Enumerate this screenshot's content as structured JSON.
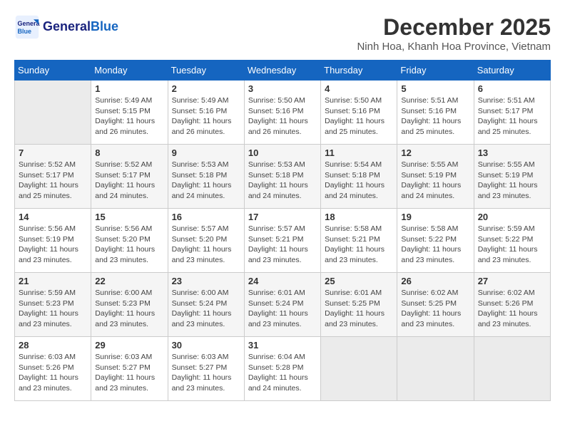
{
  "header": {
    "logo_line1": "General",
    "logo_line2": "Blue",
    "month": "December 2025",
    "location": "Ninh Hoa, Khanh Hoa Province, Vietnam"
  },
  "weekdays": [
    "Sunday",
    "Monday",
    "Tuesday",
    "Wednesday",
    "Thursday",
    "Friday",
    "Saturday"
  ],
  "weeks": [
    [
      {
        "day": "",
        "info": ""
      },
      {
        "day": "1",
        "info": "Sunrise: 5:49 AM\nSunset: 5:15 PM\nDaylight: 11 hours\nand 26 minutes."
      },
      {
        "day": "2",
        "info": "Sunrise: 5:49 AM\nSunset: 5:16 PM\nDaylight: 11 hours\nand 26 minutes."
      },
      {
        "day": "3",
        "info": "Sunrise: 5:50 AM\nSunset: 5:16 PM\nDaylight: 11 hours\nand 26 minutes."
      },
      {
        "day": "4",
        "info": "Sunrise: 5:50 AM\nSunset: 5:16 PM\nDaylight: 11 hours\nand 25 minutes."
      },
      {
        "day": "5",
        "info": "Sunrise: 5:51 AM\nSunset: 5:16 PM\nDaylight: 11 hours\nand 25 minutes."
      },
      {
        "day": "6",
        "info": "Sunrise: 5:51 AM\nSunset: 5:17 PM\nDaylight: 11 hours\nand 25 minutes."
      }
    ],
    [
      {
        "day": "7",
        "info": "Sunrise: 5:52 AM\nSunset: 5:17 PM\nDaylight: 11 hours\nand 25 minutes."
      },
      {
        "day": "8",
        "info": "Sunrise: 5:52 AM\nSunset: 5:17 PM\nDaylight: 11 hours\nand 24 minutes."
      },
      {
        "day": "9",
        "info": "Sunrise: 5:53 AM\nSunset: 5:18 PM\nDaylight: 11 hours\nand 24 minutes."
      },
      {
        "day": "10",
        "info": "Sunrise: 5:53 AM\nSunset: 5:18 PM\nDaylight: 11 hours\nand 24 minutes."
      },
      {
        "day": "11",
        "info": "Sunrise: 5:54 AM\nSunset: 5:18 PM\nDaylight: 11 hours\nand 24 minutes."
      },
      {
        "day": "12",
        "info": "Sunrise: 5:55 AM\nSunset: 5:19 PM\nDaylight: 11 hours\nand 24 minutes."
      },
      {
        "day": "13",
        "info": "Sunrise: 5:55 AM\nSunset: 5:19 PM\nDaylight: 11 hours\nand 23 minutes."
      }
    ],
    [
      {
        "day": "14",
        "info": "Sunrise: 5:56 AM\nSunset: 5:19 PM\nDaylight: 11 hours\nand 23 minutes."
      },
      {
        "day": "15",
        "info": "Sunrise: 5:56 AM\nSunset: 5:20 PM\nDaylight: 11 hours\nand 23 minutes."
      },
      {
        "day": "16",
        "info": "Sunrise: 5:57 AM\nSunset: 5:20 PM\nDaylight: 11 hours\nand 23 minutes."
      },
      {
        "day": "17",
        "info": "Sunrise: 5:57 AM\nSunset: 5:21 PM\nDaylight: 11 hours\nand 23 minutes."
      },
      {
        "day": "18",
        "info": "Sunrise: 5:58 AM\nSunset: 5:21 PM\nDaylight: 11 hours\nand 23 minutes."
      },
      {
        "day": "19",
        "info": "Sunrise: 5:58 AM\nSunset: 5:22 PM\nDaylight: 11 hours\nand 23 minutes."
      },
      {
        "day": "20",
        "info": "Sunrise: 5:59 AM\nSunset: 5:22 PM\nDaylight: 11 hours\nand 23 minutes."
      }
    ],
    [
      {
        "day": "21",
        "info": "Sunrise: 5:59 AM\nSunset: 5:23 PM\nDaylight: 11 hours\nand 23 minutes."
      },
      {
        "day": "22",
        "info": "Sunrise: 6:00 AM\nSunset: 5:23 PM\nDaylight: 11 hours\nand 23 minutes."
      },
      {
        "day": "23",
        "info": "Sunrise: 6:00 AM\nSunset: 5:24 PM\nDaylight: 11 hours\nand 23 minutes."
      },
      {
        "day": "24",
        "info": "Sunrise: 6:01 AM\nSunset: 5:24 PM\nDaylight: 11 hours\nand 23 minutes."
      },
      {
        "day": "25",
        "info": "Sunrise: 6:01 AM\nSunset: 5:25 PM\nDaylight: 11 hours\nand 23 minutes."
      },
      {
        "day": "26",
        "info": "Sunrise: 6:02 AM\nSunset: 5:25 PM\nDaylight: 11 hours\nand 23 minutes."
      },
      {
        "day": "27",
        "info": "Sunrise: 6:02 AM\nSunset: 5:26 PM\nDaylight: 11 hours\nand 23 minutes."
      }
    ],
    [
      {
        "day": "28",
        "info": "Sunrise: 6:03 AM\nSunset: 5:26 PM\nDaylight: 11 hours\nand 23 minutes."
      },
      {
        "day": "29",
        "info": "Sunrise: 6:03 AM\nSunset: 5:27 PM\nDaylight: 11 hours\nand 23 minutes."
      },
      {
        "day": "30",
        "info": "Sunrise: 6:03 AM\nSunset: 5:27 PM\nDaylight: 11 hours\nand 23 minutes."
      },
      {
        "day": "31",
        "info": "Sunrise: 6:04 AM\nSunset: 5:28 PM\nDaylight: 11 hours\nand 24 minutes."
      },
      {
        "day": "",
        "info": ""
      },
      {
        "day": "",
        "info": ""
      },
      {
        "day": "",
        "info": ""
      }
    ]
  ]
}
